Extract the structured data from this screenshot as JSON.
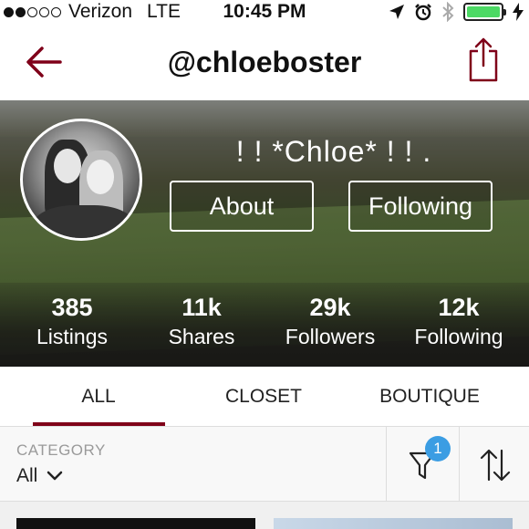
{
  "status_bar": {
    "carrier": "Verizon",
    "network": "LTE",
    "time": "10:45 PM",
    "signal_bars": 2,
    "signal_total": 5,
    "battery_level": 1.0,
    "battery_color": "#4cd964"
  },
  "nav": {
    "title": "@chloeboster",
    "back_icon": "back-arrow-icon",
    "share_icon": "share-icon",
    "accent_color": "#7f0019"
  },
  "profile": {
    "display_name": "! ! *Chloe* ! ! .",
    "about_label": "About",
    "following_button_label": "Following",
    "stats": [
      {
        "value": "385",
        "label": "Listings"
      },
      {
        "value": "11k",
        "label": "Shares"
      },
      {
        "value": "29k",
        "label": "Followers"
      },
      {
        "value": "12k",
        "label": "Following"
      }
    ]
  },
  "tabs": [
    {
      "label": "ALL",
      "active": true
    },
    {
      "label": "CLOSET",
      "active": false
    },
    {
      "label": "BOUTIQUE",
      "active": false
    }
  ],
  "filter_bar": {
    "category_label": "CATEGORY",
    "category_value": "All",
    "filter_badge_count": "1",
    "badge_color": "#3b9de3"
  }
}
